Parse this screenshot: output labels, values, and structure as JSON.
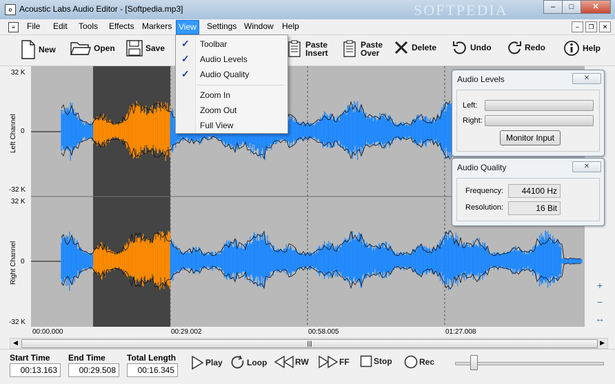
{
  "window": {
    "title": "Acoustic Labs Audio Editor - [Softpedia.mp3]",
    "watermark": "SOFTPEDIA",
    "minimize": "‒",
    "maximize": "□",
    "close": "✕"
  },
  "menubar": {
    "doc_icon": "≡",
    "items": [
      "File",
      "Edit",
      "Tools",
      "Effects",
      "Markers",
      "View",
      "Settings",
      "Window",
      "Help"
    ],
    "active": "View",
    "mdi_minimize": "‒",
    "mdi_restore": "❐",
    "mdi_close": "✕"
  },
  "toolbar": {
    "new": "New",
    "open": "Open",
    "save": "Save",
    "paste_insert_1": "Paste",
    "paste_insert_2": "Insert",
    "paste_over_1": "Paste",
    "paste_over_2": "Over",
    "delete": "Delete",
    "undo": "Undo",
    "redo": "Redo",
    "help": "Help"
  },
  "view_menu": {
    "items": [
      {
        "label": "Toolbar",
        "checked": true
      },
      {
        "label": "Audio Levels",
        "checked": true
      },
      {
        "label": "Audio Quality",
        "checked": true
      },
      {
        "label": "Zoom In",
        "checked": false
      },
      {
        "label": "Zoom Out",
        "checked": false
      },
      {
        "label": "Full View",
        "checked": false
      }
    ],
    "check_glyph": "✓"
  },
  "waveform": {
    "left_channel": "Left Channel",
    "right_channel": "Right Channel",
    "y_top": "32 K",
    "y_mid": "0",
    "y_bottom": "-32 K",
    "wave_color": "#1e88ff",
    "selection_color": "#ff8c00",
    "selection_bg": "#444444",
    "time_labels": [
      "00:00.000",
      "00:29.002",
      "00:58.005",
      "01:27.008"
    ]
  },
  "audio_levels": {
    "title": "Audio Levels",
    "close_glyph": "✕",
    "left_label": "Left:",
    "right_label": "Right:",
    "left_level": 0,
    "right_level": 0,
    "monitor_button": "Monitor Input"
  },
  "audio_quality": {
    "title": "Audio Quality",
    "close_glyph": "✕",
    "frequency_label": "Frequency:",
    "frequency_value": "44100 Hz",
    "resolution_label": "Resolution:",
    "resolution_value": "16 Bit"
  },
  "scrollbar": {
    "left_arrow": "◀",
    "right_arrow": "▶",
    "grip": "|||"
  },
  "transport": {
    "start_time_label": "Start Time",
    "start_time": "00:13.163",
    "end_time_label": "End Time",
    "end_time": "00:29.508",
    "total_length_label": "Total Length",
    "total_length": "00:16.345",
    "play": "Play",
    "loop": "Loop",
    "rw": "RW",
    "ff": "FF",
    "stop": "Stop",
    "rec": "Rec",
    "volume": 0.12
  },
  "zoom": {
    "zoom_in": "+",
    "zoom_out": "−",
    "fit": "↔"
  }
}
